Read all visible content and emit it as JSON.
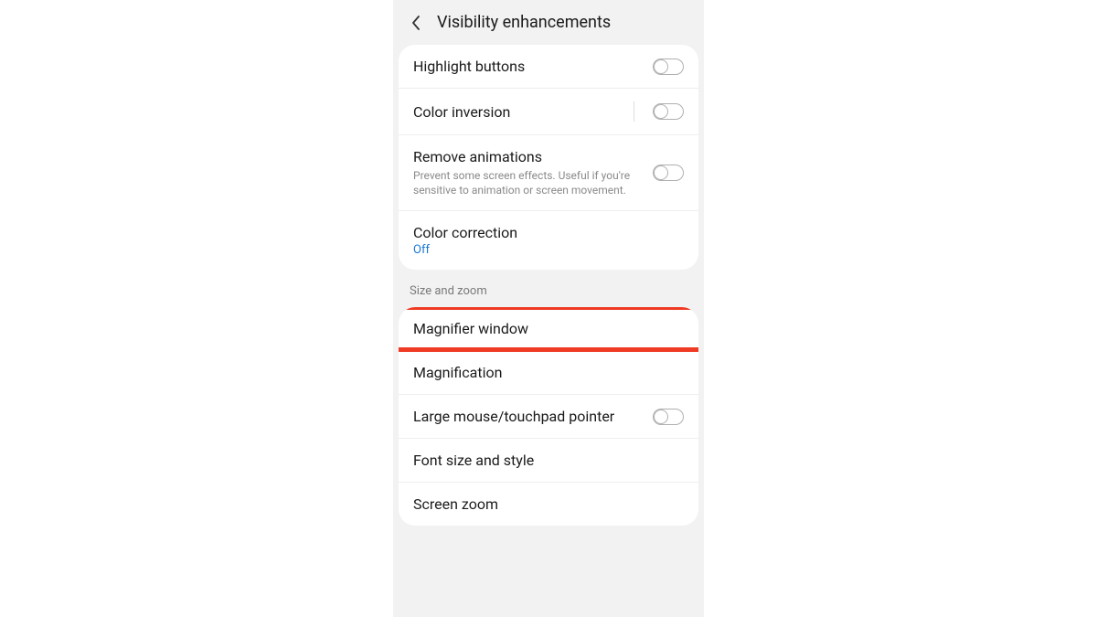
{
  "header": {
    "title": "Visibility enhancements"
  },
  "section1": {
    "items": [
      {
        "label": "Highlight buttons"
      },
      {
        "label": "Color inversion"
      },
      {
        "label": "Remove animations",
        "sublabel": "Prevent some screen effects. Useful if you're sensitive to animation or screen movement."
      },
      {
        "label": "Color correction",
        "status": "Off"
      }
    ]
  },
  "section2": {
    "header": "Size and zoom",
    "items": [
      {
        "label": "Magnifier window"
      },
      {
        "label": "Magnification"
      },
      {
        "label": "Large mouse/touchpad pointer"
      },
      {
        "label": "Font size and style"
      },
      {
        "label": "Screen zoom"
      }
    ]
  },
  "colors": {
    "highlight": "#ef3b24",
    "link": "#1976d2"
  }
}
